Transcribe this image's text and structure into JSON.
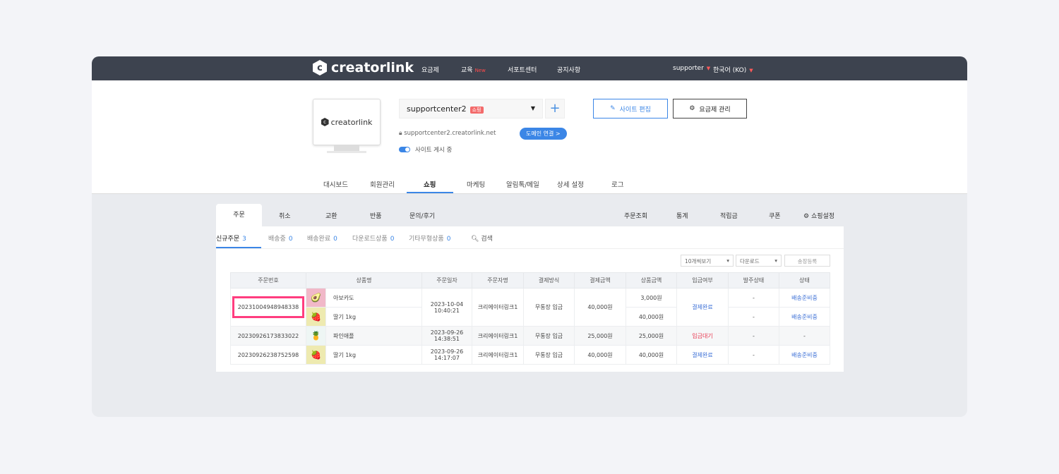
{
  "header": {
    "logo": "creatorlink",
    "nav": [
      {
        "label": "요금제"
      },
      {
        "label": "교육",
        "badge": "New"
      },
      {
        "label": "서포트센터"
      },
      {
        "label": "공지사항"
      }
    ],
    "user": "supporter",
    "language": "한국어 (KO)"
  },
  "site": {
    "preview_logo": "creatorlink",
    "name": "supportcenter2",
    "badge": "쇼핑",
    "url": "supportcenter2.creatorlink.net",
    "domain_button": "도메인 연결 >",
    "publish_status": "사이트 게시 중",
    "edit_button": "사이트 편집",
    "plan_button": "요금제 관리"
  },
  "main_tabs": [
    "대시보드",
    "회원관리",
    "쇼핑",
    "마케팅",
    "알림톡/메일",
    "상세 설정",
    "로그"
  ],
  "active_main_tab": "쇼핑",
  "shop_tabs_left": [
    "주문",
    "취소",
    "교환",
    "반품",
    "문의/후기"
  ],
  "shop_tabs_right": [
    "주문조회",
    "통계",
    "적립금",
    "쿠폰",
    "쇼핑설정"
  ],
  "sub_tabs": [
    {
      "label": "신규주문",
      "count": "3"
    },
    {
      "label": "배송중",
      "count": "0"
    },
    {
      "label": "배송완료",
      "count": "0"
    },
    {
      "label": "다운로드상품",
      "count": "0"
    },
    {
      "label": "기타무형상품",
      "count": "0"
    }
  ],
  "search_label": "검색",
  "controls": {
    "page_size": "10개씩보기",
    "download": "다운로드",
    "invoice": "송장등록"
  },
  "columns": [
    "주문번호",
    "상품명",
    "주문일자",
    "주문자명",
    "결제방식",
    "결제금액",
    "상품금액",
    "입금여부",
    "발주상태",
    "상태"
  ],
  "orders": [
    {
      "id": "20231004948948338",
      "date": "2023-10-04",
      "time": "10:40:21",
      "buyer": "크리에이터링크1",
      "method": "무통장 입금",
      "total": "40,000원",
      "paid": "결제완료",
      "items": [
        {
          "name": "아보카도",
          "icon": "avocado",
          "price": "3,000원",
          "order_status": "-",
          "status": "배송준비중"
        },
        {
          "name": "딸기 1kg",
          "icon": "strawberry",
          "price": "40,000원",
          "order_status": "-",
          "status": "배송준비중"
        }
      ]
    },
    {
      "id": "20230926173833022",
      "date": "2023-09-26",
      "time": "14:38:51",
      "buyer": "크리에이터링크1",
      "method": "무통장 입금",
      "total": "25,000원",
      "paid": "입금대기",
      "items": [
        {
          "name": "파인애플",
          "icon": "pineapple",
          "price": "25,000원",
          "order_status": "-",
          "status": "-"
        }
      ]
    },
    {
      "id": "20230926238752598",
      "date": "2023-09-26",
      "time": "14:17:07",
      "buyer": "크리에이터링크1",
      "method": "무통장 입금",
      "total": "40,000원",
      "paid": "결제완료",
      "items": [
        {
          "name": "딸기 1kg",
          "icon": "strawberry",
          "price": "40,000원",
          "order_status": "-",
          "status": "배송준비중"
        }
      ]
    }
  ],
  "colors": {
    "accent": "#3b86e6",
    "header_bg": "#3d434f",
    "highlight": "#ff3d7f",
    "pending": "#e8374f"
  }
}
